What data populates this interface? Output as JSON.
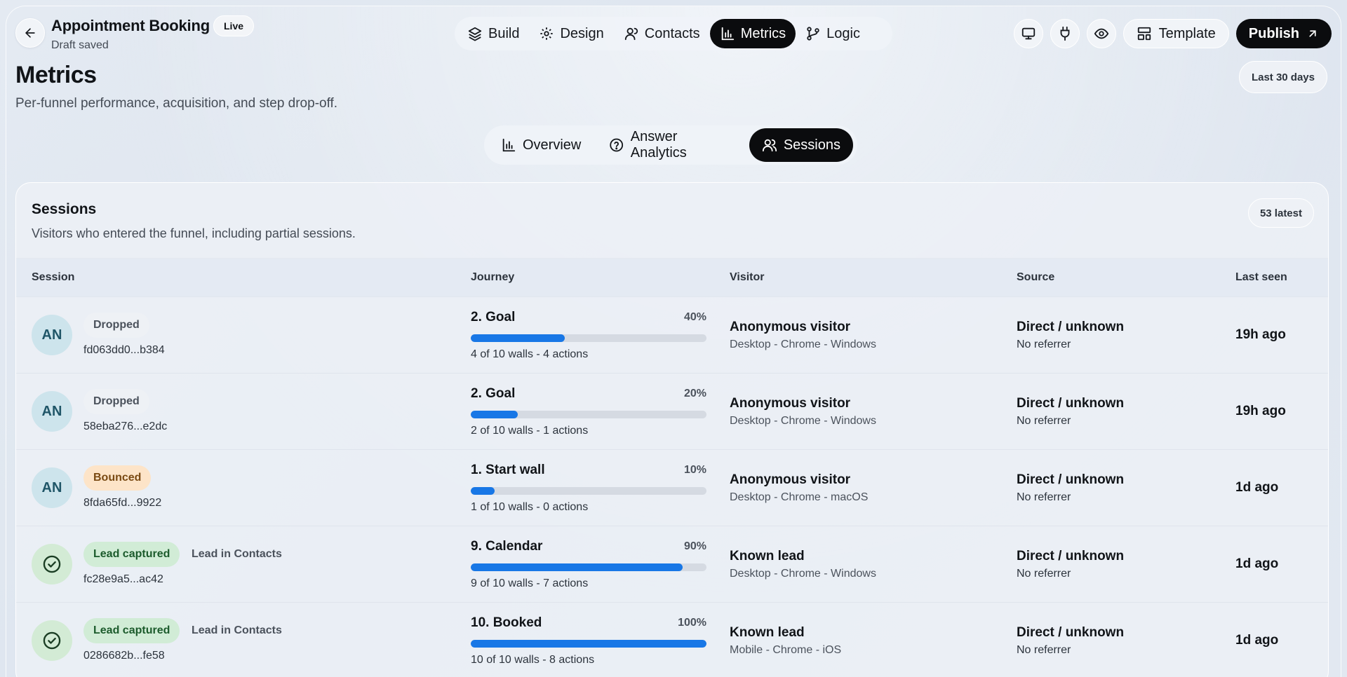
{
  "header": {
    "title": "Appointment Booking",
    "live_badge": "Live",
    "draft_status": "Draft saved",
    "nav": [
      {
        "label": "Build",
        "icon": "layers-icon"
      },
      {
        "label": "Design",
        "icon": "gear-icon"
      },
      {
        "label": "Contacts",
        "icon": "user-icon"
      },
      {
        "label": "Metrics",
        "icon": "bar-chart-icon",
        "active": true
      },
      {
        "label": "Logic",
        "icon": "git-branch-icon"
      }
    ],
    "template_label": "Template",
    "publish_label": "Publish"
  },
  "page": {
    "title": "Metrics",
    "subtitle": "Per-funnel performance, acquisition, and step drop-off.",
    "range": "Last 30 days"
  },
  "tabs": [
    {
      "label": "Overview",
      "icon": "bar-chart-icon"
    },
    {
      "label": "Answer Analytics",
      "icon": "help-circle-icon"
    },
    {
      "label": "Sessions",
      "icon": "users-icon",
      "active": true
    }
  ],
  "sessions": {
    "title": "Sessions",
    "subtitle": "Visitors who entered the funnel, including partial sessions.",
    "badge": "53 latest",
    "columns": {
      "session": "Session",
      "journey": "Journey",
      "visitor": "Visitor",
      "source": "Source",
      "last_seen": "Last seen"
    },
    "rows": [
      {
        "avatar": "AN",
        "status": "Dropped",
        "status_type": "dropped",
        "note": "",
        "id": "fd063dd0...b384",
        "step": "2. Goal",
        "percent": "40%",
        "progress": 40,
        "walls": "4 of 10 walls - 4 actions",
        "visitor": "Anonymous visitor",
        "device": "Desktop - Chrome - Windows",
        "source": "Direct / unknown",
        "referrer": "No referrer",
        "last_seen": "19h ago"
      },
      {
        "avatar": "AN",
        "status": "Dropped",
        "status_type": "dropped",
        "note": "",
        "id": "58eba276...e2dc",
        "step": "2. Goal",
        "percent": "20%",
        "progress": 20,
        "walls": "2 of 10 walls - 1 actions",
        "visitor": "Anonymous visitor",
        "device": "Desktop - Chrome - Windows",
        "source": "Direct / unknown",
        "referrer": "No referrer",
        "last_seen": "19h ago"
      },
      {
        "avatar": "AN",
        "status": "Bounced",
        "status_type": "bounced",
        "note": "",
        "id": "8fda65fd...9922",
        "step": "1. Start wall",
        "percent": "10%",
        "progress": 10,
        "walls": "1 of 10 walls - 0 actions",
        "visitor": "Anonymous visitor",
        "device": "Desktop - Chrome - macOS",
        "source": "Direct / unknown",
        "referrer": "No referrer",
        "last_seen": "1d ago"
      },
      {
        "avatar": "",
        "status": "Lead captured",
        "status_type": "lead",
        "note": "Lead in Contacts",
        "id": "fc28e9a5...ac42",
        "step": "9. Calendar",
        "percent": "90%",
        "progress": 90,
        "walls": "9 of 10 walls - 7 actions",
        "visitor": "Known lead",
        "device": "Desktop - Chrome - Windows",
        "source": "Direct / unknown",
        "referrer": "No referrer",
        "last_seen": "1d ago"
      },
      {
        "avatar": "",
        "status": "Lead captured",
        "status_type": "lead",
        "note": "Lead in Contacts",
        "id": "0286682b...fe58",
        "step": "10. Booked",
        "percent": "100%",
        "progress": 100,
        "walls": "10 of 10 walls - 8 actions",
        "visitor": "Known lead",
        "device": "Mobile - Chrome - iOS",
        "source": "Direct / unknown",
        "referrer": "No referrer",
        "last_seen": "1d ago"
      }
    ]
  }
}
